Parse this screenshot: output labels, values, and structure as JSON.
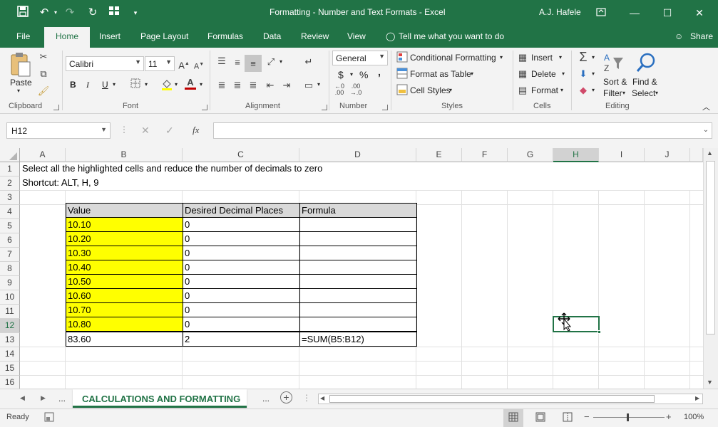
{
  "title_bar": {
    "document_title": "Formatting - Number and Text Formats  -  Excel",
    "user_name": "A.J. Hafele",
    "qat_icons": [
      "save-icon",
      "undo-icon",
      "redo-icon",
      "refresh-icon",
      "form-icon",
      "customize-icon"
    ]
  },
  "tabs": [
    "File",
    "Home",
    "Insert",
    "Page Layout",
    "Formulas",
    "Data",
    "Review",
    "View"
  ],
  "active_tab": "Home",
  "tell_me": "Tell me what you want to do",
  "share": "Share",
  "ribbon": {
    "clipboard": {
      "paste": "Paste",
      "label": "Clipboard"
    },
    "font": {
      "name": "Calibri",
      "size": "11",
      "bold": "B",
      "italic": "I",
      "underline": "U",
      "label": "Font"
    },
    "alignment": {
      "label": "Alignment"
    },
    "number": {
      "format": "General",
      "currency": "$",
      "percent": "%",
      "comma": ",",
      "label": "Number"
    },
    "styles": {
      "conditional": "Conditional Formatting",
      "format_table": "Format as Table",
      "cell_styles": "Cell Styles",
      "label": "Styles"
    },
    "cells": {
      "insert": "Insert",
      "delete": "Delete",
      "format": "Format",
      "label": "Cells"
    },
    "editing": {
      "sort": "Sort &",
      "filter": "Filter",
      "find": "Find &",
      "select": "Select",
      "label": "Editing"
    }
  },
  "formula_bar": {
    "name_box": "H12",
    "fx": "fx",
    "value": ""
  },
  "columns": [
    "A",
    "B",
    "C",
    "D",
    "E",
    "F",
    "G",
    "H",
    "I",
    "J"
  ],
  "selected_column": "H",
  "rows": [
    "1",
    "2",
    "3",
    "4",
    "5",
    "6",
    "7",
    "8",
    "9",
    "10",
    "11",
    "12",
    "13",
    "14",
    "15",
    "16"
  ],
  "selected_row": "12",
  "sheet": {
    "a1": "Select all the highlighted cells and reduce the number of decimals to zero",
    "a2": "Shortcut: ALT, H, 9",
    "table_headers": [
      "Value",
      "Desired Decimal Places",
      "Formula"
    ],
    "table_rows": [
      [
        "10.10",
        "0",
        ""
      ],
      [
        "10.20",
        "0",
        ""
      ],
      [
        "10.30",
        "0",
        ""
      ],
      [
        "10.40",
        "0",
        ""
      ],
      [
        "10.50",
        "0",
        ""
      ],
      [
        "10.60",
        "0",
        ""
      ],
      [
        "10.70",
        "0",
        ""
      ],
      [
        "10.80",
        "0",
        ""
      ]
    ],
    "total_row": [
      "83.60",
      "2",
      "=SUM(B5:B12)"
    ]
  },
  "sheet_tabs": {
    "active": "CALCULATIONS AND FORMATTING",
    "more": "..."
  },
  "status": {
    "ready": "Ready",
    "zoom": "100%"
  },
  "colors": {
    "brand": "#217346",
    "highlight": "#ffff00",
    "header_fill": "#d9d9d9"
  }
}
